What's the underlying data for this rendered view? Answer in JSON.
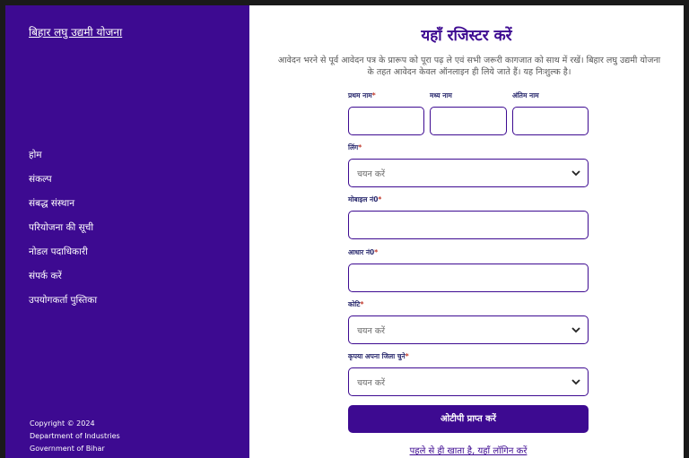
{
  "sidebar": {
    "brand": "बिहार लघु उद्यमी योजना",
    "items": [
      {
        "label": "होम"
      },
      {
        "label": "संकल्प"
      },
      {
        "label": "संबद्ध संस्थान"
      },
      {
        "label": "परियोजना की सूची"
      },
      {
        "label": "नोडल पदाधिकारी"
      },
      {
        "label": "संपर्क करें"
      },
      {
        "label": "उपयोगकर्ता पुस्तिका"
      }
    ],
    "footer": {
      "copyright": "Copyright © 2024",
      "department": "Department of Industries",
      "government": "Government of Bihar"
    }
  },
  "main": {
    "title": "यहाँ रजिस्टर करें",
    "intro": "आवेदन भरने से पूर्व आवेदन पत्र के प्रारूप को पूरा पढ़ ले एवं सभी जरूरी कागजात को साथ में रखें। बिहार लघु उद्यमी योजना के तहत आवेदन केवल ऑनलाइन ही लिये जाते हैं। यह निःशुल्क है।",
    "form": {
      "first_name_label": "प्रथम नाम",
      "middle_name_label": "मध्य नाम",
      "last_name_label": "अंतिम नाम",
      "gender_label": "लिंग",
      "gender_value": "चयन करें",
      "mobile_label": "मोबाइल नं0",
      "aadhar_label": "आधार नं0",
      "category_label": "कोटि",
      "category_value": "चयन करें",
      "district_label": "कृपया अपना जिला चुने",
      "district_value": "चयन करें",
      "required_mark": "*"
    },
    "submit_label": "ओटीपी प्राप्त करें",
    "login_link": "पहले से ही खाता है, यहाँ लॉगिन करें"
  },
  "colors": {
    "primary": "#3d0a91",
    "required": "#c0392b"
  }
}
